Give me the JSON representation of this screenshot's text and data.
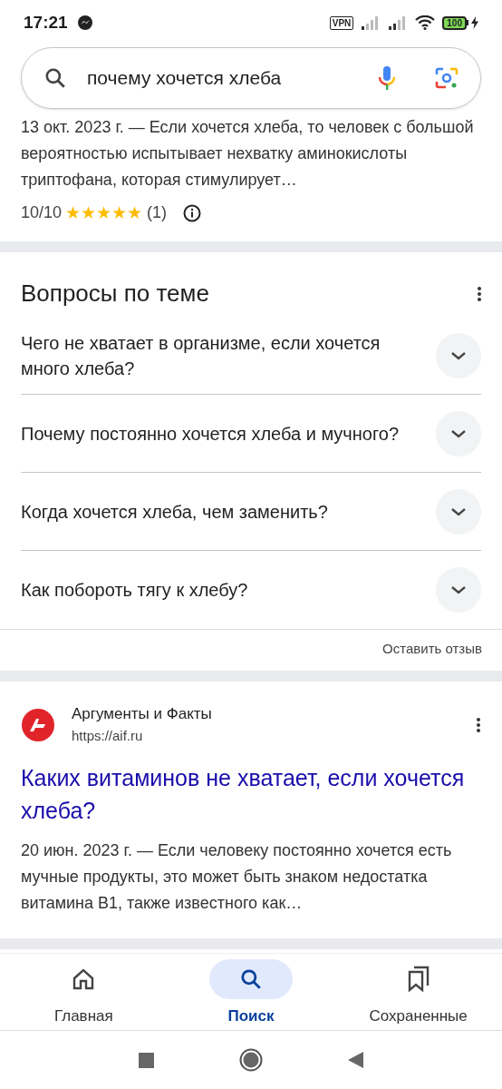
{
  "status_bar": {
    "time": "17:21",
    "vpn": "VPN",
    "battery": "100"
  },
  "search": {
    "value": "почему хочется хлеба"
  },
  "top_result": {
    "snippet": "13 окт. 2023 г. — Если хочется хлеба, то человек с большой вероятностью испытывает нехватку аминокислоты триптофана, которая стимулирует…",
    "score": "10/10",
    "stars": 5,
    "votes": "(1)"
  },
  "related_questions": {
    "title": "Вопросы по теме",
    "questions": [
      {
        "text": "Чего не хватает в организме, если хочется много хлеба?",
        "expanded": false
      },
      {
        "text": "Почему постоянно хочется хлеба и мучного?",
        "expanded": false
      },
      {
        "text": "Когда хочется хлеба, чем заменить?",
        "expanded": false
      },
      {
        "text": "Как побороть тягу к хлебу?",
        "expanded": false
      }
    ],
    "feedback": "Оставить отзыв"
  },
  "result": {
    "site": "Аргументы и Факты",
    "url": "https://aif.ru",
    "title": "Каких витаминов не хватает, если хочется хлеба?",
    "snippet": "20 июн. 2023 г. — Если человеку постоянно хочется есть мучные продукты, это может быть знаком недостатка витамина B1, также известного как…"
  },
  "bottom_nav": [
    {
      "label": "Главная",
      "kind": "home",
      "selected": false
    },
    {
      "label": "Поиск",
      "kind": "search",
      "selected": true
    },
    {
      "label": "Сохраненные",
      "kind": "saved",
      "selected": false
    }
  ]
}
